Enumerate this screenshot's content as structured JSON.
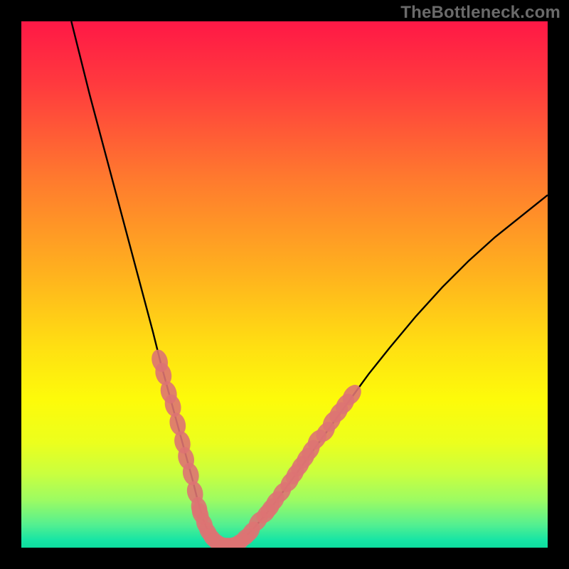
{
  "watermark": "TheBottleneck.com",
  "chart_data": {
    "type": "line",
    "title": "",
    "xlabel": "",
    "ylabel": "",
    "xlim": [
      0,
      100
    ],
    "ylim": [
      0,
      100
    ],
    "curve": {
      "name": "bottleneck-curve",
      "x": [
        9.5,
        11,
        13,
        15,
        17,
        19,
        21,
        23,
        25,
        26.5,
        28,
        29.5,
        31,
        32.5,
        33.5,
        34.5,
        35.5,
        37,
        38.5,
        40,
        42,
        44,
        47,
        50,
        54,
        58,
        62,
        66,
        70,
        75,
        80,
        85,
        90,
        95,
        100
      ],
      "y": [
        100,
        94,
        86,
        78.5,
        71,
        63.5,
        56,
        48.5,
        41,
        35,
        29.5,
        24,
        18.5,
        13,
        9,
        5.5,
        3,
        1.2,
        0.4,
        0.4,
        1.5,
        3.5,
        7,
        11,
        16.5,
        22,
        27.5,
        33,
        38,
        44,
        49.5,
        54.5,
        59,
        63,
        67
      ]
    },
    "marker_groups": [
      {
        "name": "left-band",
        "rgba": "rgba(221,115,115,0.9)",
        "points": [
          {
            "x": 26.3,
            "y": 35.5
          },
          {
            "x": 27.0,
            "y": 33.0
          },
          {
            "x": 28.0,
            "y": 29.5
          },
          {
            "x": 28.8,
            "y": 27.0
          },
          {
            "x": 29.7,
            "y": 23.5
          },
          {
            "x": 30.6,
            "y": 20.0
          },
          {
            "x": 31.3,
            "y": 17.0
          },
          {
            "x": 32.2,
            "y": 14.0
          },
          {
            "x": 33.0,
            "y": 10.5
          },
          {
            "x": 33.8,
            "y": 7.5
          }
        ]
      },
      {
        "name": "left-band-2",
        "rgba": "rgba(221,115,115,0.9)",
        "points": [
          {
            "x": 34.0,
            "y": 6.5
          },
          {
            "x": 34.8,
            "y": 4.5
          }
        ]
      },
      {
        "name": "trough",
        "rgba": "rgba(221,115,115,0.9)",
        "points": [
          {
            "x": 35.5,
            "y": 3.0
          },
          {
            "x": 36.3,
            "y": 1.8
          },
          {
            "x": 37.2,
            "y": 1.0
          },
          {
            "x": 38.2,
            "y": 0.5
          },
          {
            "x": 39.2,
            "y": 0.4
          },
          {
            "x": 40.3,
            "y": 0.5
          },
          {
            "x": 41.4,
            "y": 1.0
          },
          {
            "x": 42.6,
            "y": 2.0
          }
        ]
      },
      {
        "name": "right-band-low",
        "rgba": "rgba(221,115,115,0.9)",
        "points": [
          {
            "x": 43.6,
            "y": 3.0
          },
          {
            "x": 45.0,
            "y": 5.0
          },
          {
            "x": 46.5,
            "y": 6.5
          },
          {
            "x": 47.3,
            "y": 7.5
          }
        ]
      },
      {
        "name": "right-band-mid",
        "rgba": "rgba(221,115,115,0.9)",
        "points": [
          {
            "x": 48.2,
            "y": 8.8
          },
          {
            "x": 49.5,
            "y": 10.5
          },
          {
            "x": 51.0,
            "y": 12.5
          }
        ]
      },
      {
        "name": "right-band",
        "rgba": "rgba(221,115,115,0.9)",
        "points": [
          {
            "x": 52.0,
            "y": 14.0
          },
          {
            "x": 53.0,
            "y": 15.5
          },
          {
            "x": 54.0,
            "y": 17.0
          },
          {
            "x": 55.0,
            "y": 18.5
          },
          {
            "x": 56.2,
            "y": 20.5
          },
          {
            "x": 57.8,
            "y": 22.0
          },
          {
            "x": 59.0,
            "y": 24.0
          },
          {
            "x": 60.3,
            "y": 25.7
          },
          {
            "x": 61.5,
            "y": 27.3
          },
          {
            "x": 62.8,
            "y": 29.0
          }
        ]
      }
    ],
    "gradient_stops": [
      {
        "offset": 0.0,
        "color": "#ff1846"
      },
      {
        "offset": 0.12,
        "color": "#ff3a3e"
      },
      {
        "offset": 0.3,
        "color": "#ff7a2e"
      },
      {
        "offset": 0.48,
        "color": "#ffb21e"
      },
      {
        "offset": 0.62,
        "color": "#ffe012"
      },
      {
        "offset": 0.72,
        "color": "#fdfb0a"
      },
      {
        "offset": 0.8,
        "color": "#ecff1d"
      },
      {
        "offset": 0.86,
        "color": "#c9ff3f"
      },
      {
        "offset": 0.91,
        "color": "#9cfb63"
      },
      {
        "offset": 0.955,
        "color": "#56f08f"
      },
      {
        "offset": 0.985,
        "color": "#18e5a4"
      },
      {
        "offset": 1.0,
        "color": "#0ddc9e"
      }
    ]
  }
}
